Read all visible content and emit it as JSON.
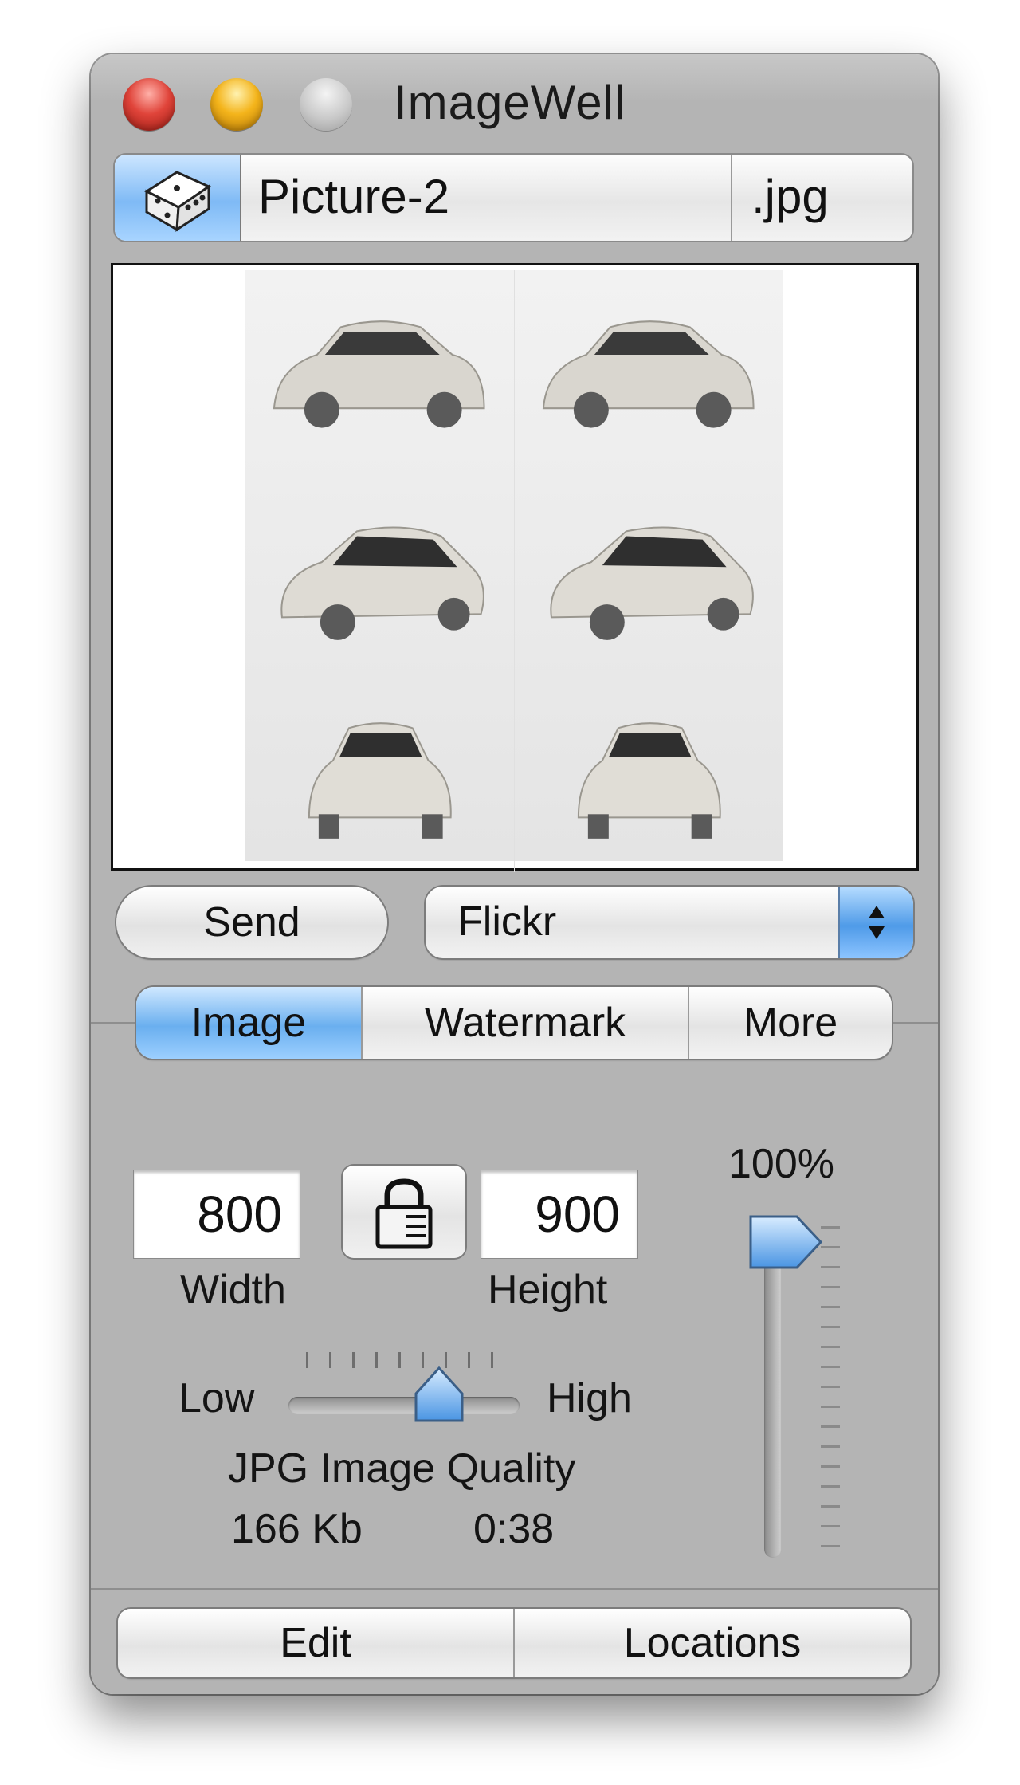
{
  "window": {
    "title": "ImageWell"
  },
  "file": {
    "name": "Picture-2",
    "extension": ".jpg"
  },
  "actions": {
    "send_label": "Send",
    "service_selected": "Flickr"
  },
  "tabs": [
    {
      "label": "Image",
      "selected": true
    },
    {
      "label": "Watermark",
      "selected": false
    },
    {
      "label": "More",
      "selected": false
    }
  ],
  "image": {
    "width_value": "800",
    "height_value": "900",
    "width_label": "Width",
    "height_label": "Height",
    "scale_label": "100%",
    "scale_percent": 100,
    "quality_low": "Low",
    "quality_high": "High",
    "quality_label": "JPG Image Quality",
    "quality_level": 0.65,
    "file_size": "166 Kb",
    "upload_time": "0:38"
  },
  "bottom_bar": {
    "edit_label": "Edit",
    "locations_label": "Locations"
  },
  "colors": {
    "accent_blue": "#6aafef",
    "window_gray": "#b4b4b4"
  },
  "icons": [
    "dice-icon",
    "lock-icon",
    "popup-arrows-icon"
  ]
}
